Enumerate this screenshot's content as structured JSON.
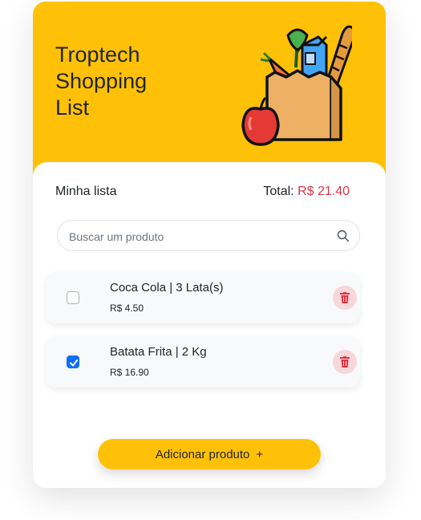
{
  "header": {
    "title": "Troptech\nShopping\nList",
    "illustration": "grocery-bag-icon"
  },
  "summary": {
    "list_label": "Minha lista",
    "total_label": "Total:",
    "total_value": "R$ 21.40"
  },
  "search": {
    "placeholder": "Buscar um produto",
    "value": "",
    "icon": "search-icon"
  },
  "items": [
    {
      "name": "Coca Cola | 3 Lata(s)",
      "price": "R$ 4.50",
      "checked": false
    },
    {
      "name": "Batata Frita | 2 Kg",
      "price": "R$ 16.90",
      "checked": true
    }
  ],
  "actions": {
    "add_label": "Adicionar produto",
    "add_icon": "+"
  },
  "colors": {
    "accent": "#ffc107",
    "total": "#dc3545",
    "checkbox": "#0d6efd",
    "delete_bg": "#f8d7da",
    "delete_icon": "#dc3545"
  }
}
